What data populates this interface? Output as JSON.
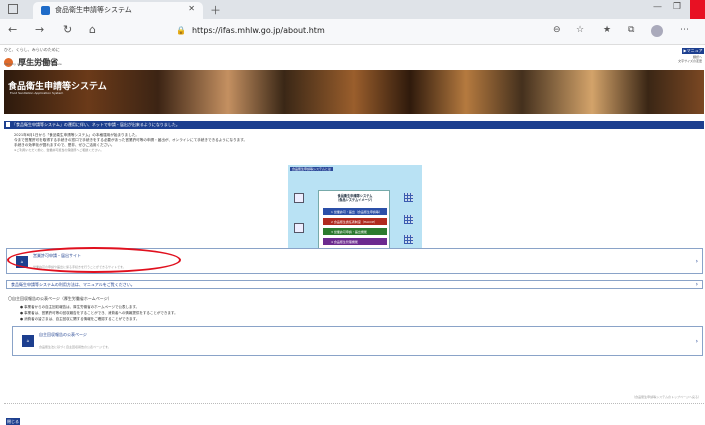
{
  "browser": {
    "tab_title": "食品衛生申請等システム",
    "url": "https://ifas.mhlw.go.jp/about.htm",
    "icons": [
      "back-icon",
      "forward-icon",
      "refresh-icon",
      "home-icon",
      "lock-icon",
      "reader-icon",
      "favorite-add-icon",
      "favorites-icon",
      "collections-icon",
      "profile-icon",
      "more-icon"
    ]
  },
  "header": {
    "slogan": "ひと、くらし、みらいのために",
    "ministry": "厚生労働省",
    "ministry_en": "Ministry of Health, Labour and Welfare",
    "manual_button": "▶マニュアル",
    "right_text_1": "翻訳へ",
    "right_text_2": "文字サイズの変更",
    "size_small": "標準",
    "size_medium": "中",
    "size_large": "大"
  },
  "banner": {
    "title": "食品衛生申請等システム",
    "subtitle": "Food Sanitation Application System"
  },
  "notice_bar": "「食品衛生申請等システム」の運用に伴い、ネットで申請・届出が出来るようになりました。",
  "intro": {
    "line1": "2021年6月1日から「食品衛生申請等システム」の本格運用が始まりました。",
    "line2": "今まで営業許可を取得する手続きの窓口で手続きをする必要があった営業許可等の申請・届出が、オンラインにて手続きできるようになります。",
    "line3": "手続きの効率化が図れますので、是非、ぜひご活用ください。",
    "note": "※ご利用いただく前に、営業許可担当の保健所へご相談ください。"
  },
  "overview": {
    "label": "食品衛生申請等システムとは",
    "heading1": "食品衛生申請等システム",
    "heading2": "（食品システムイメージ）",
    "items": [
      {
        "label": "1 営業許可・届出（食品衛生申請等）",
        "color": "#2b4fa8"
      },
      {
        "label": "2 食品衛生責任者制度（HACCP）",
        "color": "#b02a1f"
      },
      {
        "label": "3 営業許可申請・届出機能",
        "color": "#2b7a2e"
      },
      {
        "label": "4 食品衛生管理機能",
        "color": "#6b2a8f"
      }
    ]
  },
  "cards": [
    {
      "title": "営業許可申請・届出サイト",
      "desc": "営業許可の申請や届出に係る手続きを行うことができるサイトです。"
    },
    {
      "title": "食品衛生申請等システムの利用方法は、マニュアルをご覧ください。",
      "desc": ""
    },
    {
      "title": "自主回収報告の公表ページ",
      "desc": "食品衛生法に基づく自主回収報告の公表ページです。"
    }
  ],
  "recall_section": {
    "heading": "〇自主回収報告の公表ページ（厚生労働省ホームページ）",
    "bullets": [
      "● 事業者からの自主回収報告は、厚生労働省のホームページで公表します。",
      "● 事業者は、営業許可等の回収報告をすることができ、消費者への情報提供をすることができます。",
      "● 消費者の皆さまは、自主回収に関する情報をご確認することができます。"
    ]
  },
  "footer_note": "（食品衛生申請等システムのトップページへ戻る）",
  "close_button": "閉じる"
}
